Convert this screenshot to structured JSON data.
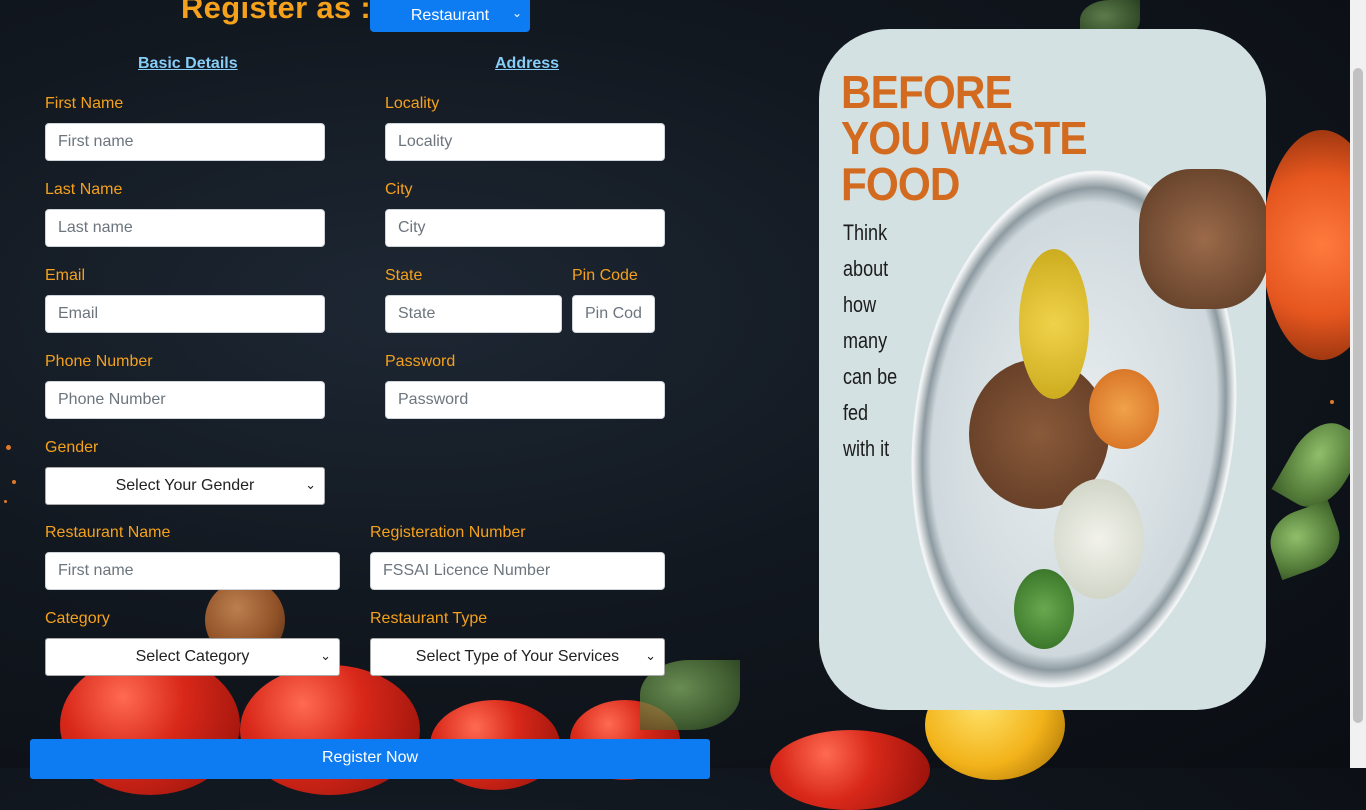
{
  "header": {
    "title": "Register as :",
    "role_select": {
      "value": "Restaurant"
    }
  },
  "sections": {
    "basic_details": "Basic Details",
    "address": "Address"
  },
  "fields": {
    "first_name": {
      "label": "First Name",
      "placeholder": "First name",
      "value": ""
    },
    "last_name": {
      "label": "Last Name",
      "placeholder": "Last name",
      "value": ""
    },
    "email": {
      "label": "Email",
      "placeholder": "Email",
      "value": ""
    },
    "phone": {
      "label": "Phone Number",
      "placeholder": "Phone Number",
      "value": ""
    },
    "gender": {
      "label": "Gender",
      "value": "Select Your Gender"
    },
    "locality": {
      "label": "Locality",
      "placeholder": "Locality",
      "value": ""
    },
    "city": {
      "label": "City",
      "placeholder": "City",
      "value": ""
    },
    "state": {
      "label": "State",
      "placeholder": "State",
      "value": ""
    },
    "pin_code": {
      "label": "Pin Code",
      "placeholder": "Pin Code",
      "value": ""
    },
    "password": {
      "label": "Password",
      "placeholder": "Password",
      "value": ""
    },
    "restaurant_name": {
      "label": "Restaurant Name",
      "placeholder": "First name",
      "value": ""
    },
    "registration_number": {
      "label": "Registeration Number",
      "placeholder": "FSSAI Licence Number",
      "value": ""
    },
    "category": {
      "label": "Category",
      "value": "Select Category"
    },
    "restaurant_type": {
      "label": "Restaurant Type",
      "value": "Select Type of Your Services"
    }
  },
  "submit_label": "Register Now",
  "poster": {
    "headline": [
      "BEFORE",
      "YOU WASTE",
      "FOOD"
    ],
    "subtext": [
      "Think about",
      "how many",
      "can be fed",
      "with it"
    ]
  },
  "colors": {
    "accent_orange": "#f5a11c",
    "primary_blue": "#0d7bf2",
    "link_blue": "#86cdf7",
    "poster_orange": "#d26b1f"
  }
}
